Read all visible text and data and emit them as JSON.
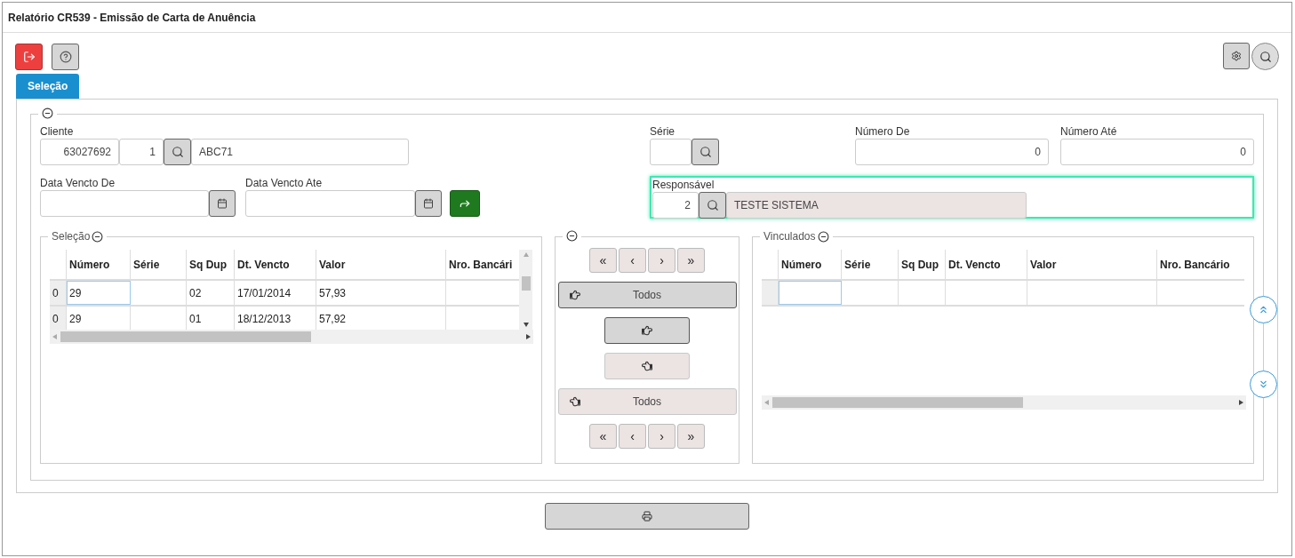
{
  "window": {
    "title": "Relatório CR539 - Emissão de Carta de Anuência"
  },
  "tabs": [
    {
      "label": "Seleção",
      "selected": true
    }
  ],
  "filters": {
    "cliente": {
      "label": "Cliente",
      "code": "63027692",
      "seq": "1",
      "name": "ABC71"
    },
    "serie": {
      "label": "Série"
    },
    "numero_de": {
      "label": "Número De",
      "value": "0"
    },
    "numero_ate": {
      "label": "Número Até",
      "value": "0"
    },
    "data_vencto_de": {
      "label": "Data Vencto De"
    },
    "data_vencto_ate": {
      "label": "Data Vencto Ate"
    },
    "responsavel": {
      "label": "Responsável",
      "code": "2",
      "name": "TESTE SISTEMA",
      "focused": true
    }
  },
  "selecao": {
    "title": "Seleção",
    "columns": [
      "Número",
      "Série",
      "Sq Dup",
      "Dt. Vencto",
      "Valor",
      "Nro. Bancári"
    ],
    "rows": [
      {
        "row_header": "0",
        "focused": true,
        "cells": [
          "29",
          "",
          "02",
          "17/01/2014",
          "57,93",
          ""
        ]
      },
      {
        "row_header": "0",
        "focused": false,
        "cells": [
          "29",
          "",
          "01",
          "18/12/2013",
          "57,92",
          ""
        ]
      }
    ]
  },
  "transfer": {
    "nav_top": [
      "«",
      "‹",
      "›",
      "»"
    ],
    "buttons": [
      {
        "kind": "all_right",
        "label": "Todos",
        "disabled": false
      },
      {
        "kind": "right",
        "disabled": false
      },
      {
        "kind": "left",
        "disabled": true
      },
      {
        "kind": "all_left",
        "label": "Todos",
        "disabled": true
      }
    ],
    "nav_bottom": [
      "«",
      "‹",
      "›",
      "»"
    ]
  },
  "vinculados": {
    "title": "Vinculados",
    "columns": [
      "Número",
      "Série",
      "Sq Dup",
      "Dt. Vencto",
      "Valor",
      "Nro. Bancário"
    ],
    "rows": [
      {
        "focused": true
      }
    ]
  }
}
